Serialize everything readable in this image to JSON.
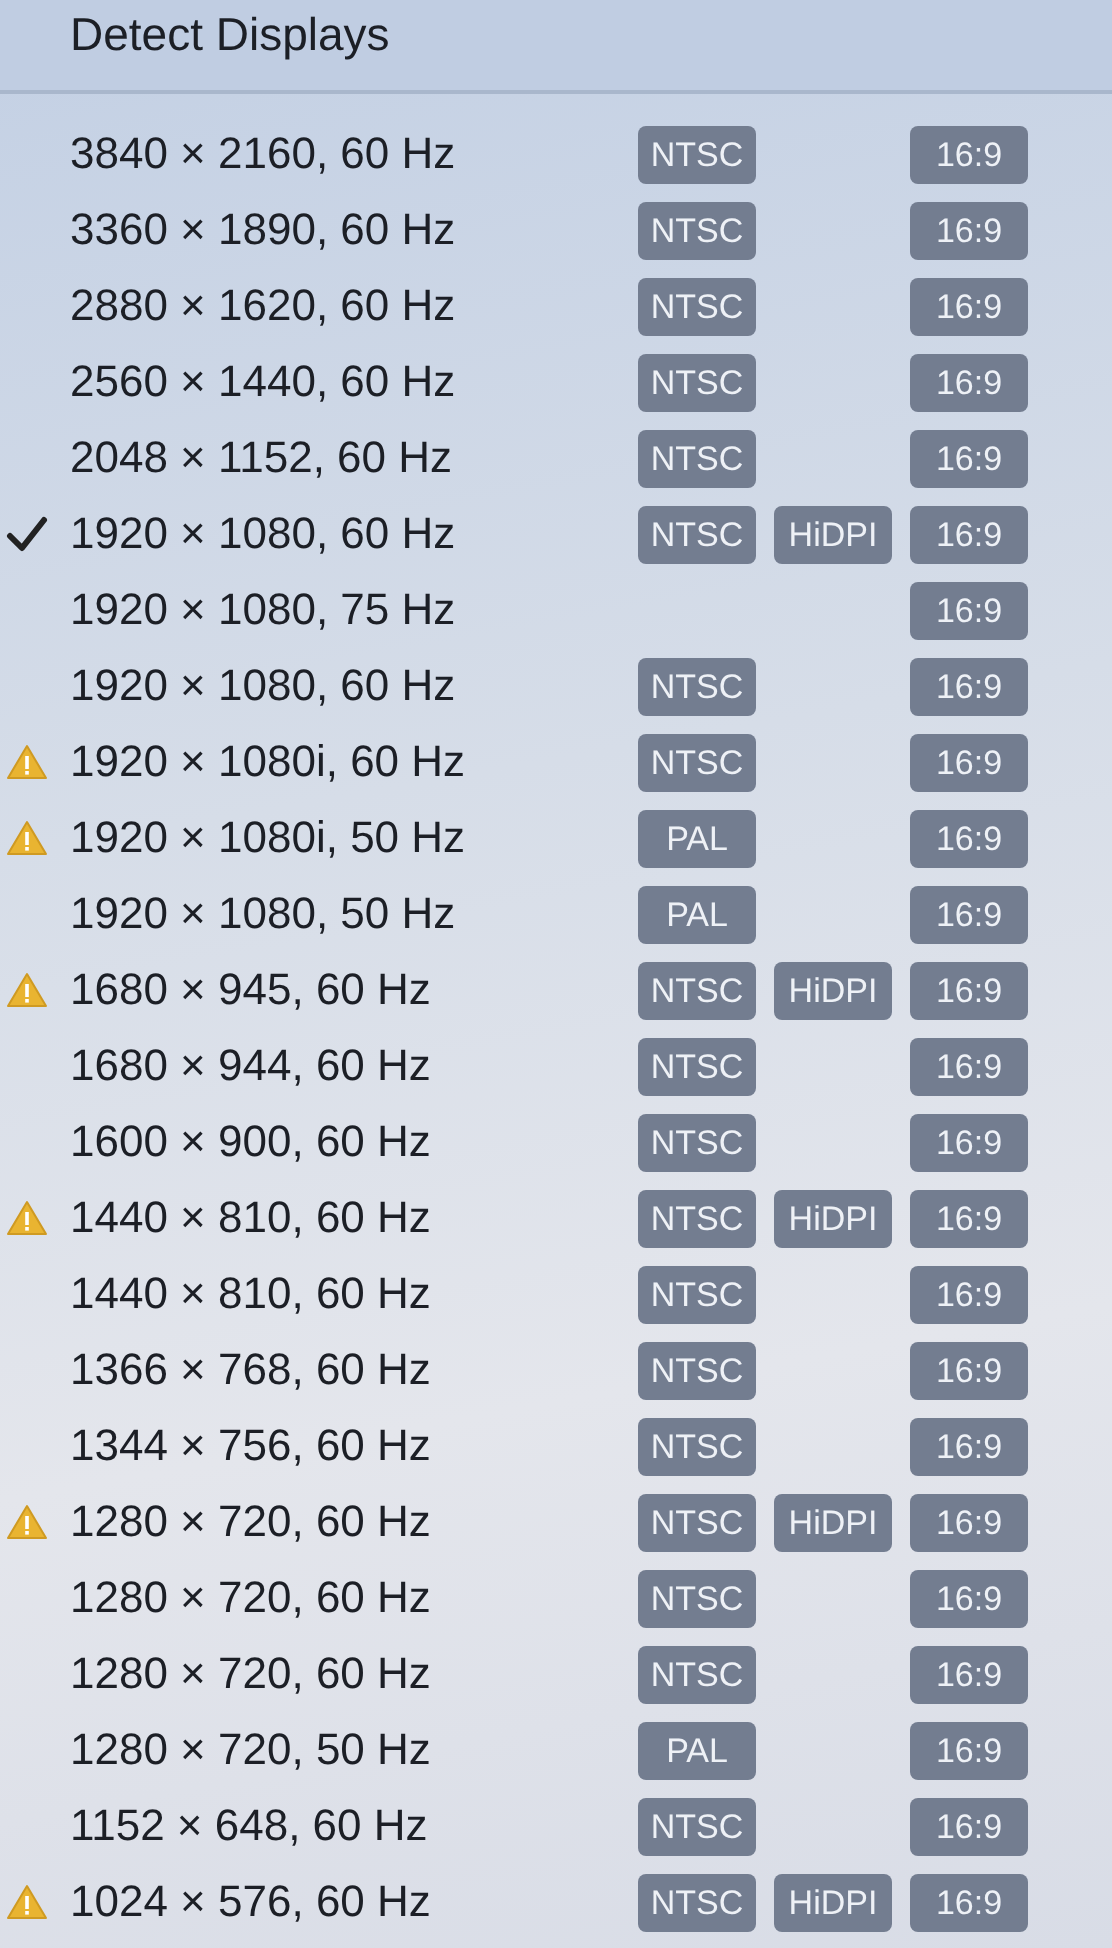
{
  "header": {
    "title": "Detect Displays"
  },
  "modes": [
    {
      "label": "3840 × 2160, 60 Hz",
      "selected": false,
      "warning": false,
      "signal": "NTSC",
      "aspect": "16:9"
    },
    {
      "label": "3360 × 1890, 60 Hz",
      "selected": false,
      "warning": false,
      "signal": "NTSC",
      "aspect": "16:9"
    },
    {
      "label": "2880 × 1620, 60 Hz",
      "selected": false,
      "warning": false,
      "signal": "NTSC",
      "aspect": "16:9"
    },
    {
      "label": "2560 × 1440, 60 Hz",
      "selected": false,
      "warning": false,
      "signal": "NTSC",
      "aspect": "16:9"
    },
    {
      "label": "2048 × 1152, 60 Hz",
      "selected": false,
      "warning": false,
      "signal": "NTSC",
      "aspect": "16:9"
    },
    {
      "label": "1920 × 1080, 60 Hz",
      "selected": true,
      "warning": false,
      "signal": "NTSC",
      "hidpi": "HiDPI",
      "aspect": "16:9"
    },
    {
      "label": "1920 × 1080, 75 Hz",
      "selected": false,
      "warning": false,
      "aspect": "16:9"
    },
    {
      "label": "1920 × 1080, 60 Hz",
      "selected": false,
      "warning": false,
      "signal": "NTSC",
      "aspect": "16:9"
    },
    {
      "label": "1920 × 1080i, 60 Hz",
      "selected": false,
      "warning": true,
      "signal": "NTSC",
      "aspect": "16:9"
    },
    {
      "label": "1920 × 1080i, 50 Hz",
      "selected": false,
      "warning": true,
      "signal": "PAL",
      "aspect": "16:9"
    },
    {
      "label": "1920 × 1080, 50 Hz",
      "selected": false,
      "warning": false,
      "signal": "PAL",
      "aspect": "16:9"
    },
    {
      "label": "1680 × 945, 60 Hz",
      "selected": false,
      "warning": true,
      "signal": "NTSC",
      "hidpi": "HiDPI",
      "aspect": "16:9"
    },
    {
      "label": "1680 × 944, 60 Hz",
      "selected": false,
      "warning": false,
      "signal": "NTSC",
      "aspect": "16:9"
    },
    {
      "label": "1600 × 900, 60 Hz",
      "selected": false,
      "warning": false,
      "signal": "NTSC",
      "aspect": "16:9"
    },
    {
      "label": "1440 × 810, 60 Hz",
      "selected": false,
      "warning": true,
      "signal": "NTSC",
      "hidpi": "HiDPI",
      "aspect": "16:9"
    },
    {
      "label": "1440 × 810, 60 Hz",
      "selected": false,
      "warning": false,
      "signal": "NTSC",
      "aspect": "16:9"
    },
    {
      "label": "1366 × 768, 60 Hz",
      "selected": false,
      "warning": false,
      "signal": "NTSC",
      "aspect": "16:9"
    },
    {
      "label": "1344 × 756, 60 Hz",
      "selected": false,
      "warning": false,
      "signal": "NTSC",
      "aspect": "16:9"
    },
    {
      "label": "1280 × 720, 60 Hz",
      "selected": false,
      "warning": true,
      "signal": "NTSC",
      "hidpi": "HiDPI",
      "aspect": "16:9"
    },
    {
      "label": "1280 × 720, 60 Hz",
      "selected": false,
      "warning": false,
      "signal": "NTSC",
      "aspect": "16:9"
    },
    {
      "label": "1280 × 720, 60 Hz",
      "selected": false,
      "warning": false,
      "signal": "NTSC",
      "aspect": "16:9"
    },
    {
      "label": "1280 × 720, 50 Hz",
      "selected": false,
      "warning": false,
      "signal": "PAL",
      "aspect": "16:9"
    },
    {
      "label": "1152 × 648, 60 Hz",
      "selected": false,
      "warning": false,
      "signal": "NTSC",
      "aspect": "16:9"
    },
    {
      "label": "1024 × 576, 60 Hz",
      "selected": false,
      "warning": true,
      "signal": "NTSC",
      "hidpi": "HiDPI",
      "aspect": "16:9"
    }
  ]
}
